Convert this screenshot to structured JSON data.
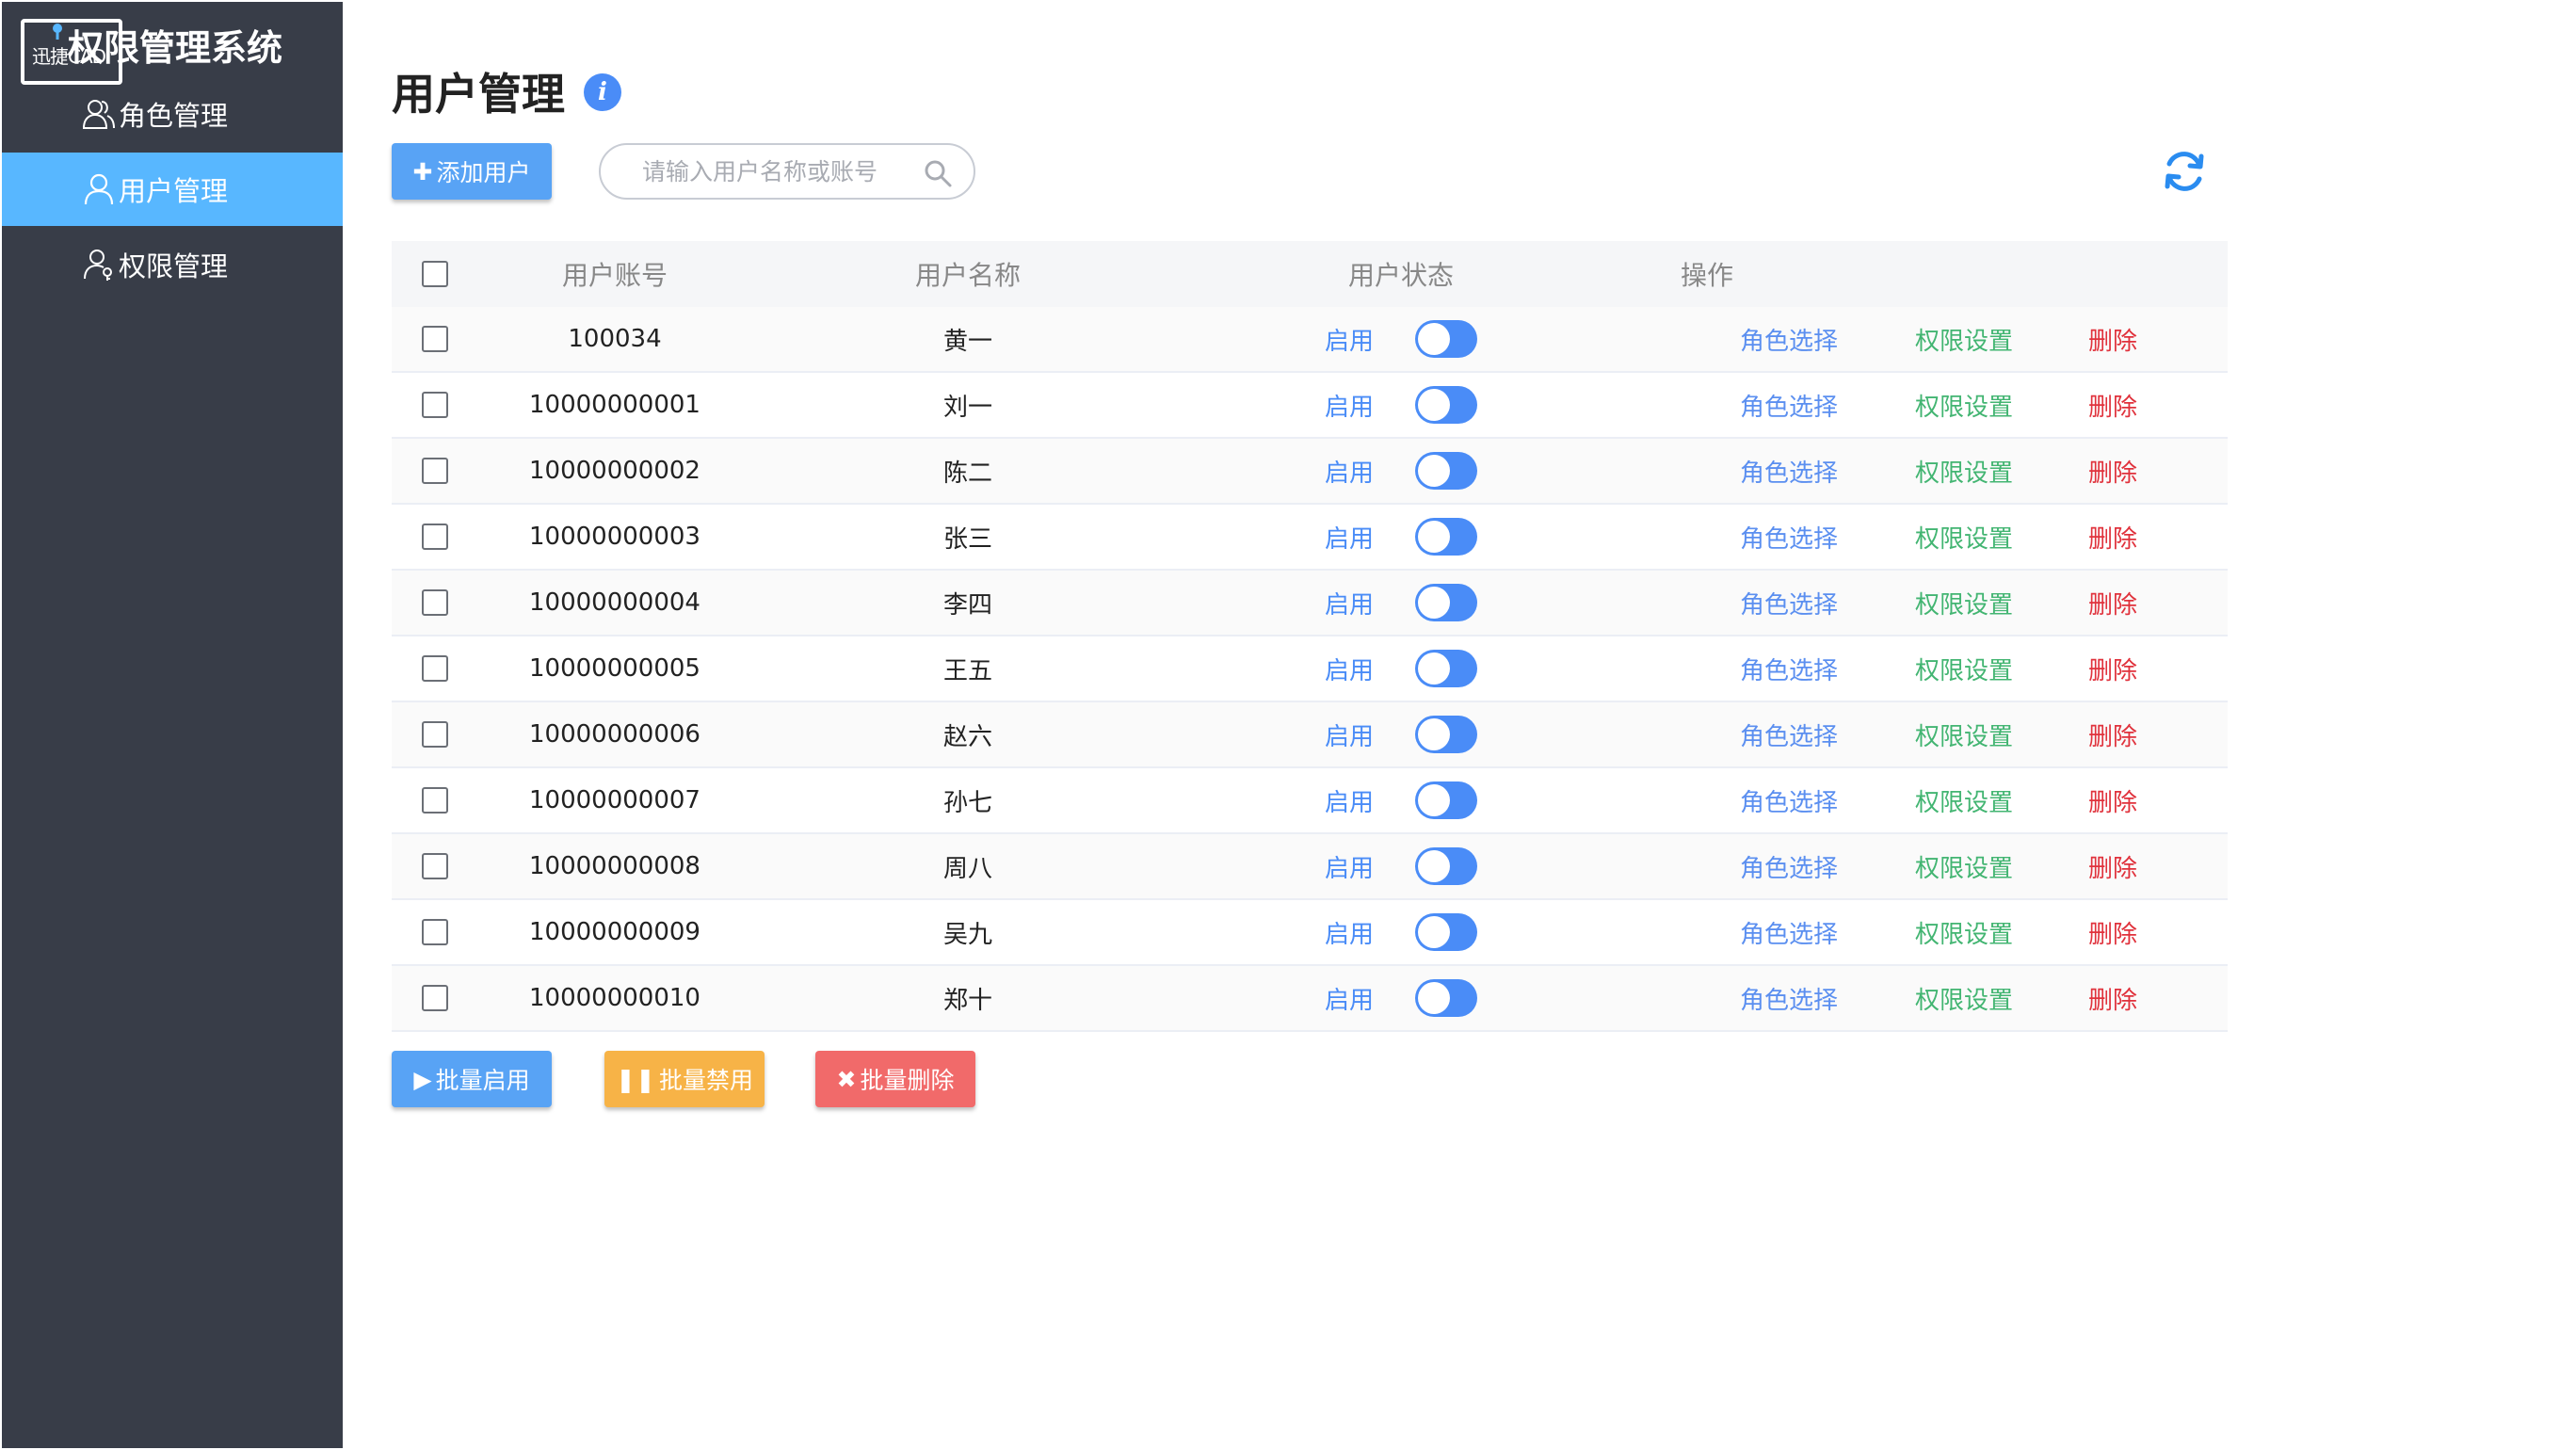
{
  "app": {
    "logo_text": "迅捷CAD",
    "system_title": "权限管理系统"
  },
  "sidebar": {
    "items": [
      {
        "label": "角色管理",
        "icon": "users-icon",
        "active": false
      },
      {
        "label": "用户管理",
        "icon": "user-icon",
        "active": true
      },
      {
        "label": "权限管理",
        "icon": "user-key-icon",
        "active": false
      }
    ]
  },
  "header": {
    "title": "用户管理",
    "info_icon_glyph": "i"
  },
  "toolbar": {
    "add_label": "添加用户",
    "search_placeholder": "请输入用户名称或账号"
  },
  "table": {
    "columns": [
      "用户账号",
      "用户名称",
      "用户状态",
      "操作"
    ],
    "actions": {
      "role": "角色选择",
      "perm": "权限设置",
      "delete": "删除"
    },
    "rows": [
      {
        "account": "100034",
        "name": "黄一",
        "status": "启用"
      },
      {
        "account": "10000000001",
        "name": "刘一",
        "status": "启用"
      },
      {
        "account": "10000000002",
        "name": "陈二",
        "status": "启用"
      },
      {
        "account": "10000000003",
        "name": "张三",
        "status": "启用"
      },
      {
        "account": "10000000004",
        "name": "李四",
        "status": "启用"
      },
      {
        "account": "10000000005",
        "name": "王五",
        "status": "启用"
      },
      {
        "account": "10000000006",
        "name": "赵六",
        "status": "启用"
      },
      {
        "account": "10000000007",
        "name": "孙七",
        "status": "启用"
      },
      {
        "account": "10000000008",
        "name": "周八",
        "status": "启用"
      },
      {
        "account": "10000000009",
        "name": "吴九",
        "status": "启用"
      },
      {
        "account": "10000000010",
        "name": "郑十",
        "status": "启用"
      }
    ]
  },
  "batch": {
    "enable_label": "批量启用",
    "disable_label": "批量禁用",
    "delete_label": "批量删除"
  },
  "colors": {
    "sidebar_bg": "#383d48",
    "sidebar_active": "#58b7ff",
    "primary": "#4a8cf7",
    "success": "#43b572",
    "warning": "#f7b347",
    "danger": "#e0323c"
  }
}
